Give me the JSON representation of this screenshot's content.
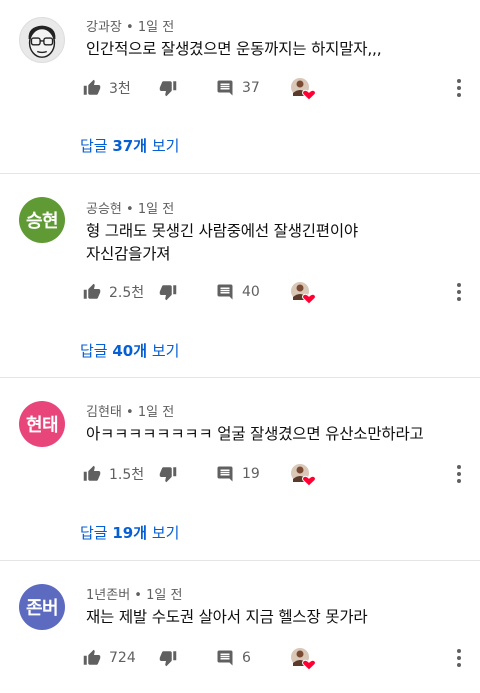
{
  "comments": [
    {
      "author": "강과장",
      "time": "1일 전",
      "avatar_text": "",
      "avatar_color": "#e9e9e9",
      "lines": [
        "인간적으로 잘생겼으면 운동까지는 하지말자,,,"
      ],
      "likes": "3천",
      "replies_count": "37",
      "replies_label": "답글 37개 보기"
    },
    {
      "author": "공승현",
      "time": "1일 전",
      "avatar_text": "승현",
      "avatar_color": "#5f9a34",
      "lines": [
        "형 그래도 못생긴 사람중에선 잘생긴편이야",
        "자신감을가져"
      ],
      "likes": "2.5천",
      "replies_count": "40",
      "replies_label": "답글 40개 보기"
    },
    {
      "author": "김현태",
      "time": "1일 전",
      "avatar_text": "현태",
      "avatar_color": "#e8457a",
      "lines": [
        "아ㅋㅋㅋㅋㅋㅋㅋㅋ 얼굴 잘생겼으면 유산소만하라고"
      ],
      "likes": "1.5천",
      "replies_count": "19",
      "replies_label": "답글 19개 보기"
    },
    {
      "author": "1년존버",
      "time": "1일 전",
      "avatar_text": "존버",
      "avatar_color": "#5c6bc0",
      "lines": [
        "재는 제발 수도권 살아서 지금 헬스장 못가라"
      ],
      "likes": "724",
      "replies_count": "6",
      "replies_label": ""
    }
  ],
  "separator": " • ",
  "icons": {
    "like": "thumb-up-icon",
    "dislike": "thumb-down-icon",
    "reply": "comment-icon",
    "creator_heart": "creator-heart-icon",
    "more": "more-vertical-icon"
  },
  "colors": {
    "link": "#065fd4",
    "meta": "#606060",
    "heart": "#ff0033"
  }
}
